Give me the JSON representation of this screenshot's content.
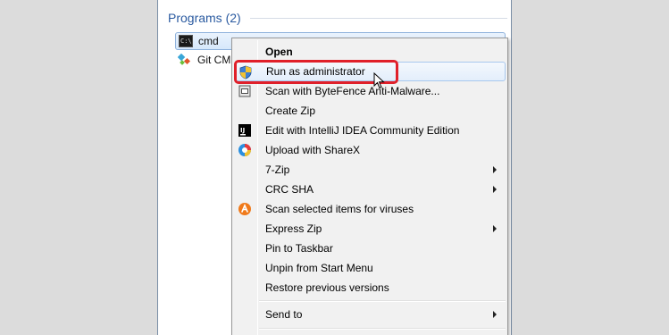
{
  "results": {
    "section_title": "Programs (2)",
    "items": [
      {
        "label": "cmd",
        "icon": "cmd-icon",
        "selected": true
      },
      {
        "label": "Git CMD",
        "icon": "git-icon",
        "selected": false
      }
    ]
  },
  "context_menu": {
    "items": [
      {
        "label": "Open",
        "bold": true
      },
      {
        "label": "Run as administrator",
        "icon": "uac-shield-icon",
        "highlighted": true
      },
      {
        "label": "Scan with ByteFence Anti-Malware...",
        "icon": "bytefence-icon"
      },
      {
        "label": "Create Zip"
      },
      {
        "label": "Edit with IntelliJ IDEA Community Edition",
        "icon": "intellij-icon"
      },
      {
        "label": "Upload with ShareX",
        "icon": "sharex-icon"
      },
      {
        "label": "7-Zip",
        "submenu": true
      },
      {
        "label": "CRC SHA",
        "submenu": true
      },
      {
        "label": "Scan selected items for viruses",
        "icon": "avast-icon"
      },
      {
        "label": "Express Zip",
        "submenu": true
      },
      {
        "label": "Pin to Taskbar"
      },
      {
        "label": "Unpin from Start Menu"
      },
      {
        "label": "Restore previous versions"
      },
      {
        "label": "Send to",
        "submenu": true
      }
    ]
  },
  "colors": {
    "highlight_ring": "#e0202a",
    "section_title": "#2a5aa0"
  }
}
